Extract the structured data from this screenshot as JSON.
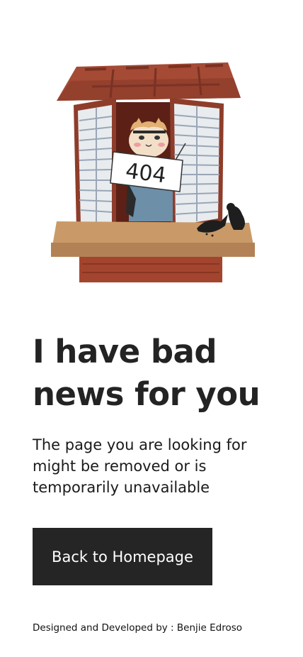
{
  "illustration": {
    "icon": "cat-in-window-404-icon",
    "sign_text": "404"
  },
  "headline": "I have bad news for you",
  "description": "The page you are looking for might be removed or is temporarily unavailable",
  "button": {
    "label": "Back to Homepage"
  },
  "footer": {
    "credit": "Designed and Developed by : Benjie Edroso"
  },
  "colors": {
    "text": "#232323",
    "button_bg": "#252525",
    "button_text": "#ffffff",
    "background": "#ffffff"
  }
}
